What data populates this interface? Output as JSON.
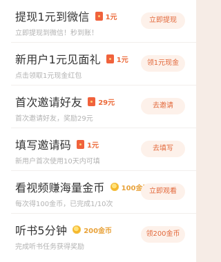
{
  "tasks": [
    {
      "title": "提现1元到微信",
      "reward": "1元",
      "reward_icon": "red-packet-icon",
      "subtitle": "立即提现到微信！秒到账！",
      "button": "立即提现"
    },
    {
      "title": "新用户1元见面礼",
      "reward": "1元",
      "reward_icon": "red-packet-icon",
      "subtitle": "点击领取1元现金红包",
      "button": "领1元现金"
    },
    {
      "title": "首次邀请好友",
      "reward": "29元",
      "reward_icon": "red-packet-icon",
      "subtitle": "首次邀请好友，奖励29元",
      "button": "去邀请"
    },
    {
      "title": "填写邀请码",
      "reward": "1元",
      "reward_icon": "red-packet-icon",
      "subtitle": "新用户首次使用10天内可填",
      "button": "去填写"
    },
    {
      "title": "看视频赚海量金币",
      "reward": "100金币",
      "reward_icon": "gold-coin-icon",
      "subtitle": "每次得100金币，已完成1/10次",
      "button": "立即观看"
    },
    {
      "title": "听书5分钟",
      "reward": "200金币",
      "reward_icon": "gold-coin-icon",
      "subtitle": "完成听书任务获得奖励",
      "button": "领200金币"
    }
  ],
  "colors": {
    "accent": "#e2693c",
    "red_packet": "#f0623c",
    "coin": "#f6b629",
    "button_bg": "#fdf1ea"
  }
}
